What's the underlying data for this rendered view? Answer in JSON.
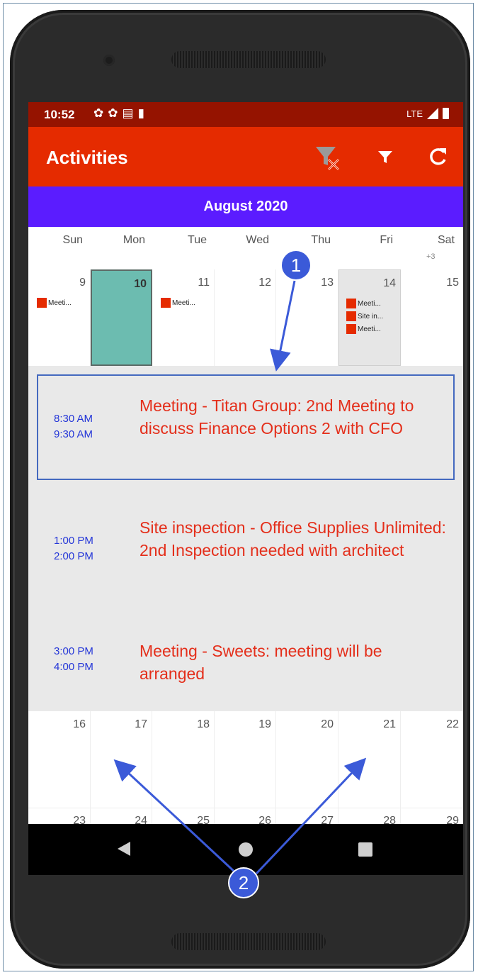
{
  "status_bar": {
    "time": "10:52",
    "icons": [
      "gear-icon",
      "gear-icon",
      "card-icon",
      "sd-card-icon"
    ],
    "network": "LTE"
  },
  "toolbar": {
    "title": "Activities",
    "actions": [
      "clear-filter-icon",
      "filter-icon",
      "refresh-icon"
    ]
  },
  "calendar": {
    "month": "August 2020",
    "weekdays": [
      "Sun",
      "Mon",
      "Tue",
      "Wed",
      "Thu",
      "Fri",
      "Sat"
    ],
    "more_count": "+3",
    "week1": {
      "days": [
        "9",
        "10",
        "11",
        "12",
        "13",
        "14",
        "15"
      ],
      "events_sun": [
        "Meeti..."
      ],
      "events_tue": [
        "Meeti..."
      ],
      "events_fri": [
        "Meeti...",
        "Site in...",
        "Meeti..."
      ]
    },
    "week2": {
      "days": [
        "16",
        "17",
        "18",
        "19",
        "20",
        "21",
        "22"
      ]
    },
    "week3": {
      "days": [
        "23",
        "24",
        "25",
        "26",
        "27",
        "28",
        "29"
      ]
    }
  },
  "agenda": [
    {
      "start": "8:30 AM",
      "end": "9:30 AM",
      "description": "Meeting  -  Titan Group: 2nd Meeting to discuss Finance Options 2 with CFO"
    },
    {
      "start": "1:00 PM",
      "end": "2:00 PM",
      "description": "Site inspection  -  Office Supplies Unlimited: 2nd Inspection needed with architect"
    },
    {
      "start": "3:00 PM",
      "end": "4:00 PM",
      "description": "Meeting  -  Sweets: meeting will be arranged"
    }
  ],
  "callouts": {
    "one": "1",
    "two": "2"
  },
  "colors": {
    "status_bar": "#951300",
    "toolbar": "#e52b00",
    "month_header": "#5b1cff",
    "today": "#6cbcb0",
    "event_chip": "#e52b00",
    "agenda_time": "#2436d8",
    "agenda_text": "#e42f1b",
    "callout": "#3b5ad8"
  }
}
